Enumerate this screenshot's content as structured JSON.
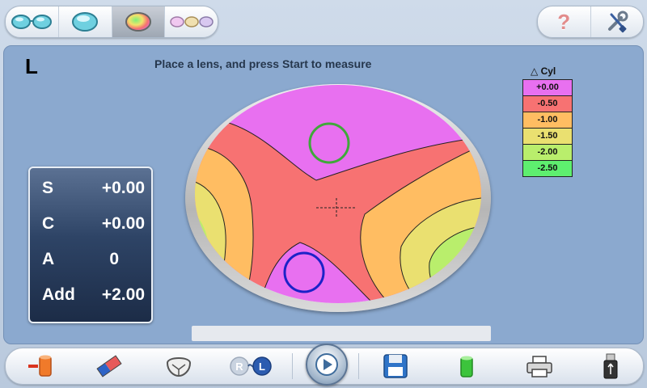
{
  "topbar": {
    "modes": [
      {
        "name": "binocular-lens-mode",
        "icon": "two-lenses-icon"
      },
      {
        "name": "single-lens-mode",
        "icon": "single-lens-icon"
      },
      {
        "name": "progressive-map-mode",
        "icon": "color-map-lens-icon",
        "active": true
      },
      {
        "name": "multi-lens-mode",
        "icon": "three-lenses-icon"
      }
    ],
    "help_glyph": "?",
    "help_icon": "question-mark-icon",
    "settings_icon": "wrench-screwdriver-icon"
  },
  "main": {
    "side_label": "L",
    "instruction": "Place a lens, and press Start to measure",
    "readout": {
      "rows": [
        {
          "label": "S",
          "value": "+0.00"
        },
        {
          "label": "C",
          "value": "+0.00"
        },
        {
          "label": "A",
          "value": "0"
        },
        {
          "label": "Add",
          "value": "+2.00"
        }
      ]
    },
    "legend": {
      "title": "△ Cyl",
      "items": [
        {
          "label": "+0.00",
          "color": "#e870f0"
        },
        {
          "label": "-0.50",
          "color": "#f77272"
        },
        {
          "label": "-1.00",
          "color": "#ffbd62"
        },
        {
          "label": "-1.50",
          "color": "#eae070"
        },
        {
          "label": "-2.00",
          "color": "#b9ee6c"
        },
        {
          "label": "-2.50",
          "color": "#5eef6f"
        }
      ]
    },
    "progress": 0
  },
  "toolbar": {
    "buttons": [
      {
        "name": "remove-lens-button",
        "icon": "orange-cylinder-minus-icon"
      },
      {
        "name": "erase-button",
        "icon": "eraser-icon"
      },
      {
        "name": "frame-button",
        "icon": "lens-frame-icon"
      },
      {
        "name": "right-left-button",
        "icon": "r-l-switch-icon",
        "r_text": "R",
        "l_text": "L"
      },
      {
        "name": "start-button",
        "icon": "play-icon"
      },
      {
        "name": "save-button",
        "icon": "floppy-disk-icon"
      },
      {
        "name": "green-cup-button",
        "icon": "green-cylinder-icon"
      },
      {
        "name": "print-button",
        "icon": "printer-icon"
      },
      {
        "name": "usb-button",
        "icon": "usb-drive-icon"
      }
    ]
  },
  "colors": {
    "panel": "#8ba9cf",
    "readout_dark": "#1c2c47",
    "accent": "#4c6f95"
  }
}
